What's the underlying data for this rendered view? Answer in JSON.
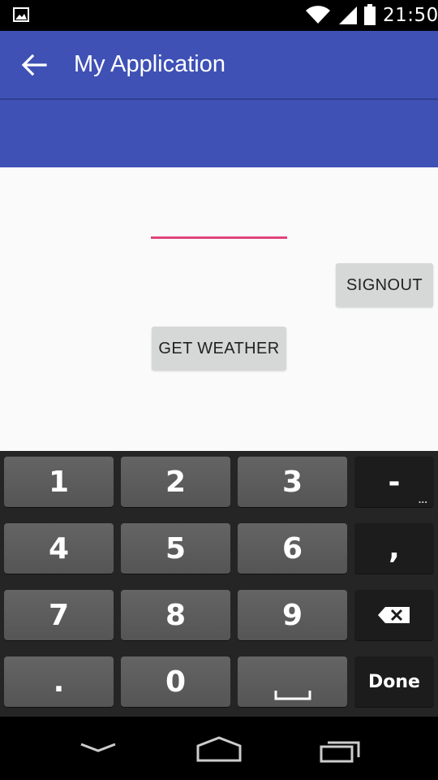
{
  "status_bar": {
    "time": "21:50",
    "icons": [
      "gallery-icon",
      "wifi-icon",
      "signal-icon",
      "battery-icon"
    ]
  },
  "app_bar": {
    "title": "My Application",
    "color": "#3f51b5",
    "back_icon": "arrow-back-icon"
  },
  "content": {
    "input": {
      "value": "",
      "placeholder": "",
      "accent_color": "#e0457b"
    },
    "signout_label": "SIGNOUT",
    "get_weather_label": "GET WEATHER"
  },
  "keyboard": {
    "rows": [
      [
        "1",
        "2",
        "3",
        "-"
      ],
      [
        "4",
        "5",
        "6",
        ","
      ],
      [
        "7",
        "8",
        "9",
        "backspace-icon"
      ],
      [
        ".",
        "0",
        "space-icon",
        "Done"
      ]
    ],
    "done_label": "Done",
    "more_indicator": "..."
  },
  "nav_bar": {
    "icons": [
      "back-icon",
      "home-icon",
      "recents-icon"
    ]
  }
}
